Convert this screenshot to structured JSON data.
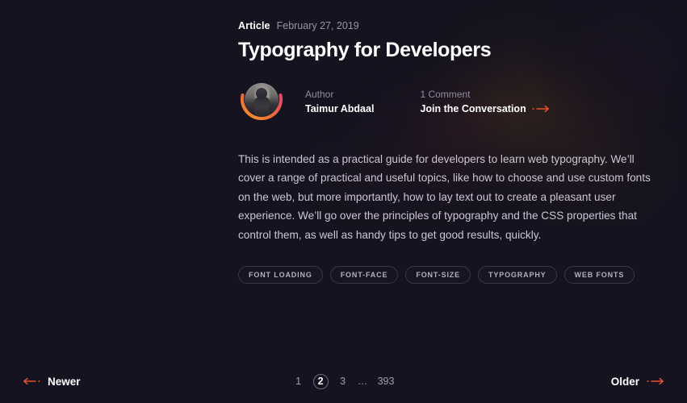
{
  "theme": {
    "background": "#15131f",
    "accent": "#e8502a",
    "text_primary": "#ffffff",
    "text_muted": "#9a93a6",
    "body_text": "#ccc6d4",
    "tag_border": "#3a3547",
    "avatar_ring_start": "#f5952f",
    "avatar_ring_end": "#e0456a"
  },
  "article": {
    "kicker_type": "Article",
    "kicker_date": "February 27, 2019",
    "title": "Typography for Developers",
    "author": {
      "label": "Author",
      "name": "Taimur Abdaal",
      "avatar_icon": "user-avatar"
    },
    "comments": {
      "label": "1 Comment",
      "cta": "Join the Conversation",
      "cta_arrow_icon": "arrow-right-icon"
    },
    "excerpt": "This is intended as a practical guide for developers to learn web typography. We’ll cover a range of practical and useful topics, like how to choose and use custom fonts on the web, but more importantly, how to lay text out to create a pleasant user experience. We’ll go over the principles of typography and the CSS properties that control them, as well as handy tips to get good results, quickly.",
    "tags": [
      "Font Loading",
      "Font-Face",
      "Font-Size",
      "Typography",
      "Web Fonts"
    ]
  },
  "footer": {
    "newer": {
      "label": "Newer",
      "arrow_icon": "arrow-left-icon"
    },
    "older": {
      "label": "Older",
      "arrow_icon": "arrow-right-icon"
    },
    "pagination": {
      "pages": [
        "1",
        "2",
        "3",
        "…",
        "393"
      ],
      "active": "2"
    }
  }
}
